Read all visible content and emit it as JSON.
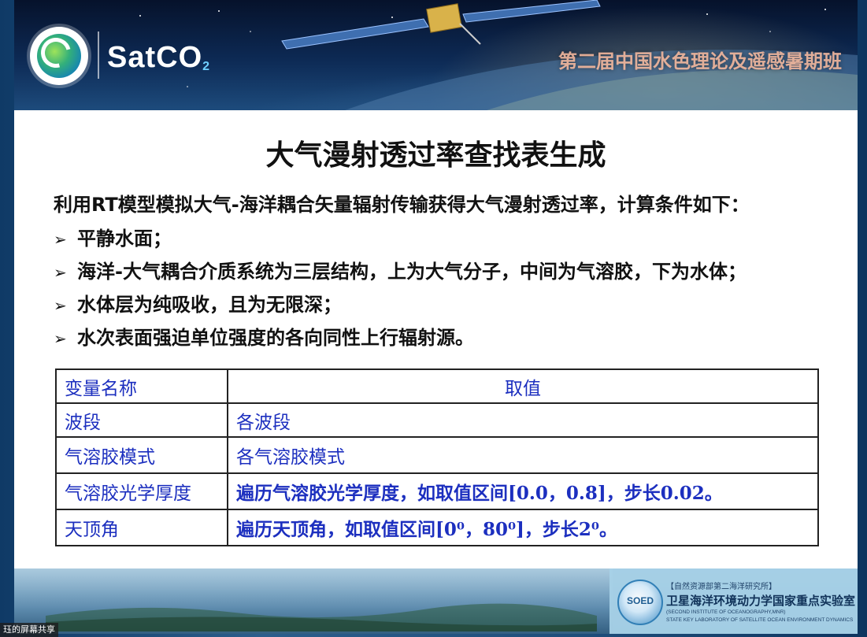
{
  "header": {
    "brand": "SatCO",
    "brand_suffix": "2",
    "banner_title": "第二届中国水色理论及遥感暑期班"
  },
  "slide": {
    "title": "大气漫射透过率查找表生成",
    "intro": "利用RT模型模拟大气-海洋耦合矢量辐射传输获得大气漫射透过率，计算条件如下：",
    "bullet_marker": "➢",
    "bullets": [
      "平静水面；",
      "海洋-大气耦合介质系统为三层结构，上为大气分子，中间为气溶胶，下为水体；",
      "水体层为纯吸收，且为无限深；",
      "水次表面强迫单位强度的各向同性上行辐射源。"
    ]
  },
  "table": {
    "headers": [
      "变量名称",
      "取值"
    ],
    "rows": [
      [
        "波段",
        "各波段"
      ],
      [
        "气溶胶模式",
        "各气溶胶模式"
      ],
      [
        "气溶胶光学厚度",
        "遍历气溶胶光学厚度，如取值区间[0.0，0.8]，步长0.02。"
      ],
      [
        "天顶角",
        "遍历天顶角，如取值区间[0⁰，80⁰]，步长2⁰。"
      ]
    ]
  },
  "footer": {
    "lab_logo_text": "SOED",
    "lab_line1": "【自然资源部第二海洋研究所】",
    "lab_line2": "卫星海洋环境动力学国家重点实验室",
    "lab_line3": "(SECOND INSTITUTE OF OCEANOGRAPHY,MNR)",
    "lab_line4": "STATE KEY LABORATORY OF SATELLITE OCEAN ENVIRONMENT DYNAMICS"
  },
  "overlay": {
    "share_label": "珏的屏幕共享"
  },
  "colors": {
    "table_text": "#1c2fbf",
    "title_text": "#111111"
  }
}
